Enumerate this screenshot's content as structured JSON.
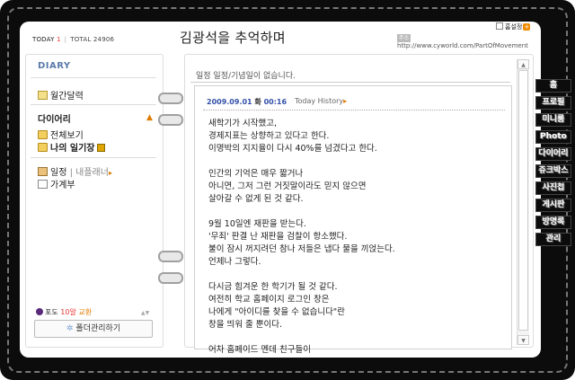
{
  "header": {
    "today_label": "TODAY",
    "today_value": "1",
    "total_label": "TOTAL",
    "total_value": "24906",
    "title": "김광석을 추억하며",
    "home_label": "홈설정",
    "url_tag": "주소",
    "url": "http://www.cyworld.com/PartOfMovement"
  },
  "sidebar": {
    "title": "DIARY",
    "monthly_calendar": "월간달력",
    "section_title": "다이어리",
    "view_all": "전체보기",
    "my_diary": "나의 일기장",
    "schedule": "일정",
    "my_planner": "내플래너",
    "ledger": "가계부",
    "grape_label": "포도",
    "grape_count": "10알",
    "exchange": "교환",
    "folder_manage": "폴더관리하기"
  },
  "main": {
    "empty_message": "일정 일정/기념일이 없습니다.",
    "post_date": "2009.09.01",
    "post_day": "화",
    "post_time": "00:16",
    "history_link": "Today History",
    "paragraphs": [
      "새학기가 시작했고,\n경제지표는 상향하고 있다고 한다.\n이명박의 지지율이 다시 40%를 넘겼다고 한다.",
      "인간의 기억은 매우 짧거나\n아니면, 그저 그런 거짓말이라도 믿지 않으면\n살아갈 수 없게 된 것 같다.",
      "9월 10일엔 재판을 받는다.\n'무죄' 판결 난 재판을 검찰이 항소했다.\n불이 잠시 꺼지려던 참나 저들은 냅다 물을 끼얹는다.\n언제나 그렇다.",
      "다시금 힘겨운 한 학기가 될 것 같다.\n여전히 학교 홈페이지 로그인 창은\n나에게 \"아이디를 찾을 수 없습니다\"란\n창을 띄워 줄 뿐이다.",
      "어차 홈페이드 멘데 친구들이"
    ]
  },
  "side_tabs": [
    "홈",
    "프로필",
    "미니룸",
    "Photo",
    "다이어리",
    "쥬크박스",
    "사진첩",
    "게시판",
    "방명록",
    "관리"
  ]
}
